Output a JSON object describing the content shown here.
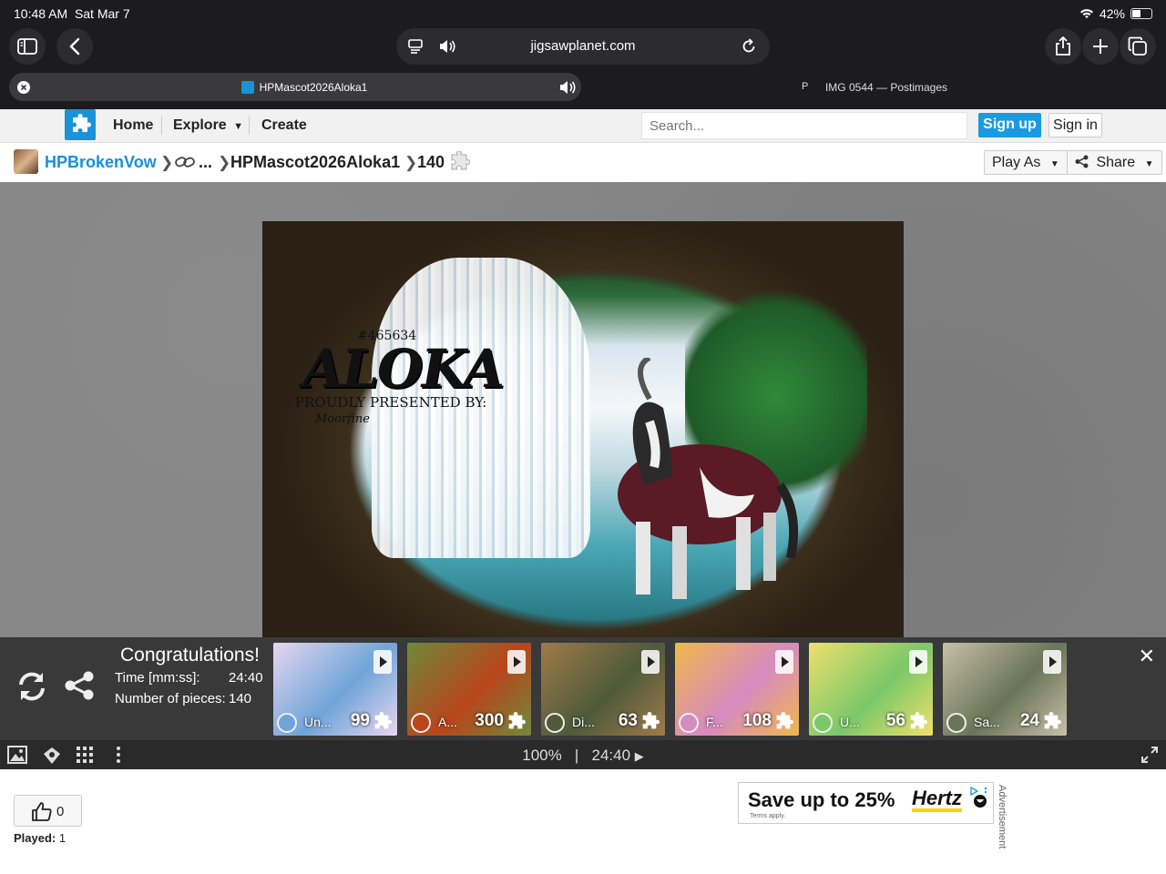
{
  "status_bar": {
    "time": "10:48 AM",
    "date": "Sat Mar 7",
    "battery": "42%"
  },
  "browser": {
    "url_domain": "jigsawplanet.com",
    "active_tab_title": "HPMascot2026Aloka1",
    "other_tab_favicon_letter": "P",
    "other_tab_title": "IMG 0544 — Postimages"
  },
  "site_nav": {
    "home": "Home",
    "explore": "Explore",
    "create": "Create",
    "search_placeholder": "Search...",
    "sign_up": "Sign up",
    "sign_in": "Sign in"
  },
  "breadcrumb": {
    "user": "HPBrokenVow",
    "ellipsis": "...",
    "puzzle_name": "HPMascot2026Aloka1",
    "pieces": "140",
    "play_as": "Play As",
    "share": "Share"
  },
  "puzzle_image": {
    "id_text": "#465634",
    "title_text": "ALOKA",
    "presented_text": "PROUDLY PRESENTED BY:",
    "author_text": "Moorfine"
  },
  "completion": {
    "title": "Congratulations!",
    "time_label": "Time [mm:ss]:",
    "time_value": "24:40",
    "pieces_label": "Number of pieces:",
    "pieces_value": "140"
  },
  "suggestions": [
    {
      "name": "Un...",
      "count": "99",
      "color_a": "#6fa4d8",
      "color_b": "#e8d6f0"
    },
    {
      "name": "A...",
      "count": "300",
      "color_a": "#b8451c",
      "color_b": "#6e8a3a"
    },
    {
      "name": "Di...",
      "count": "63",
      "color_a": "#4e5a3a",
      "color_b": "#a07a4a"
    },
    {
      "name": "F...",
      "count": "108",
      "color_a": "#d68ac0",
      "color_b": "#f0b84a"
    },
    {
      "name": "U...",
      "count": "56",
      "color_a": "#7ac86a",
      "color_b": "#f0e06a"
    },
    {
      "name": "Sa...",
      "count": "24",
      "color_a": "#6a7458",
      "color_b": "#c8c0a8"
    }
  ],
  "toolbar": {
    "zoom": "100%",
    "separator": "|",
    "timer": "24:40"
  },
  "stats": {
    "likes": "0",
    "played_label": "Played:",
    "played_value": "1"
  },
  "advert": {
    "headline": "Save up to 25%",
    "brand": "Hertz",
    "terms": "Terms apply.",
    "label": "Advertisement"
  }
}
